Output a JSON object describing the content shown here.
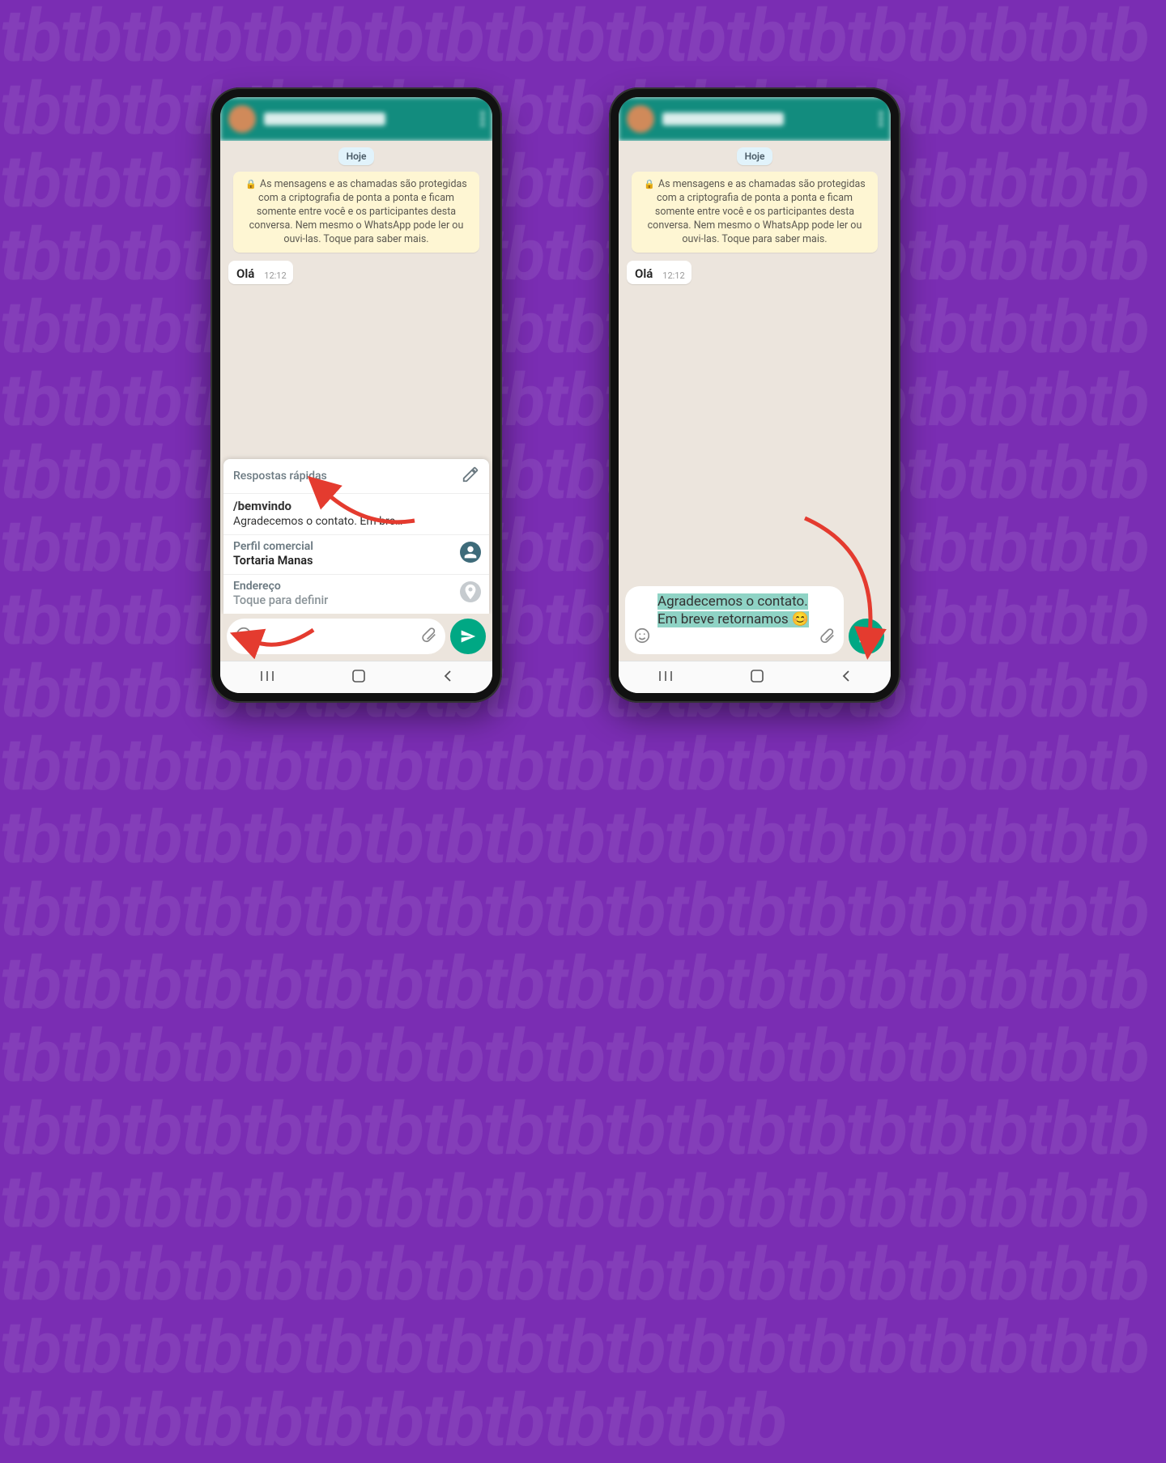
{
  "date_chip": "Hoje",
  "encryption_notice": "As mensagens e as chamadas são protegidas com a criptografia de ponta a ponta e ficam somente entre você e os participantes desta conversa. Nem mesmo o WhatsApp pode ler ou ouvi-las. Toque para saber mais.",
  "incoming_message": {
    "text": "Olá",
    "time": "12:12"
  },
  "left_phone": {
    "input_text": "/",
    "quick_replies": {
      "header": "Respostas rápidas",
      "item": {
        "command": "/bemvindo",
        "preview": "Agradecemos o contato. Em bre…"
      },
      "profile": {
        "label": "Perfil comercial",
        "value": "Tortaria Manas"
      },
      "address": {
        "label": "Endereço",
        "value": "Toque para definir"
      }
    }
  },
  "right_phone": {
    "input_text": "Agradecemos o contato. Em breve retornamos 😊"
  }
}
